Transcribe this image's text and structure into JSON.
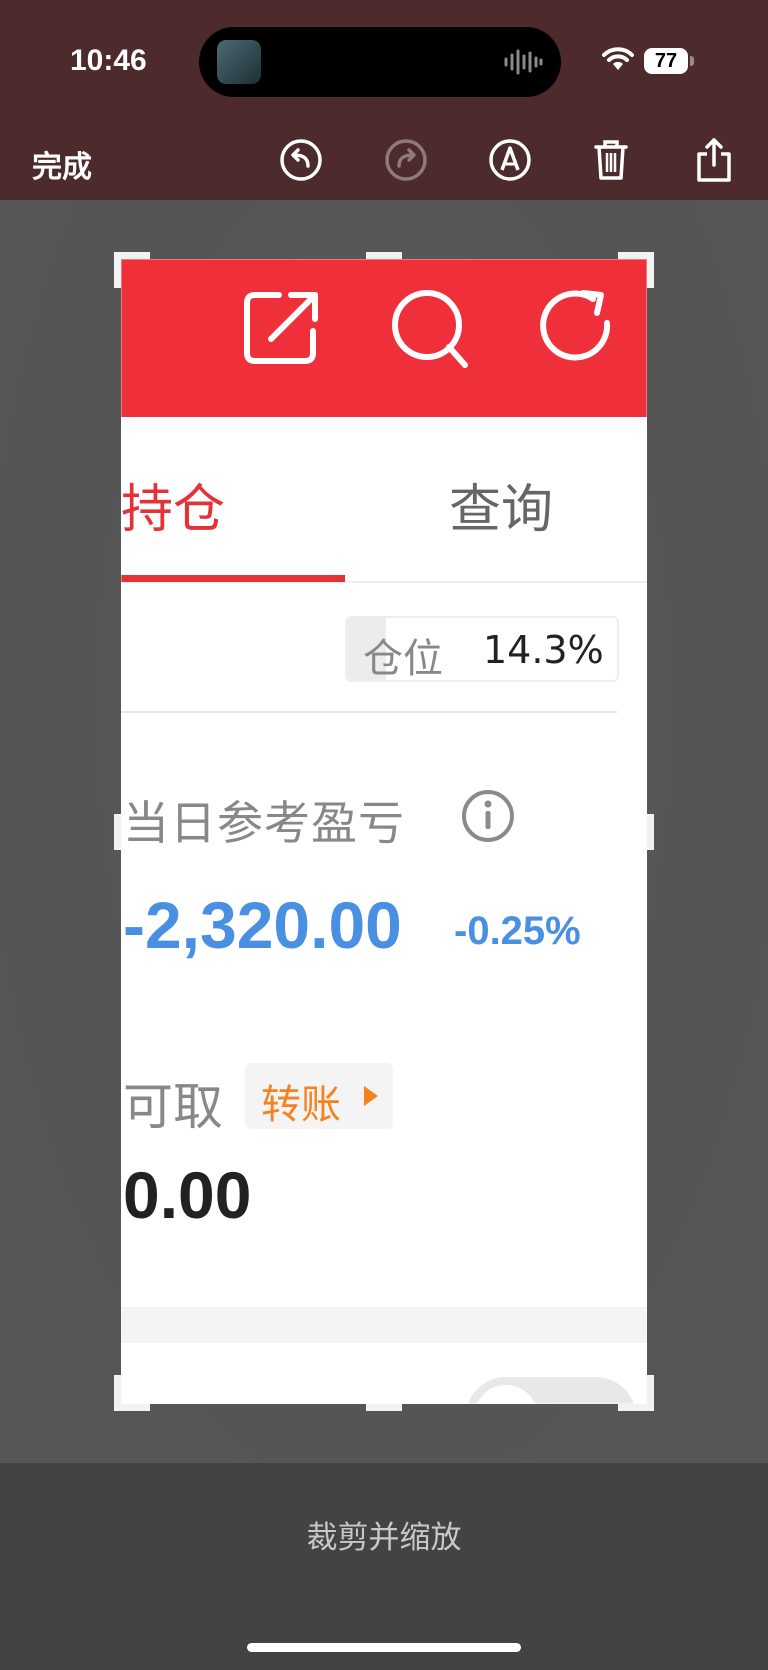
{
  "status_bar": {
    "time": "10:46",
    "battery": "77"
  },
  "toolbar": {
    "done_label": "完成"
  },
  "app": {
    "tabs": [
      "持仓",
      "查询"
    ],
    "position": {
      "label": "仓位",
      "value": "14.3%",
      "fraction": 0.143
    },
    "daily_pnl": {
      "label": "当日参考盈亏",
      "value": "-2,320.00",
      "percent": "-0.25%"
    },
    "available": {
      "label": "可取",
      "transfer_label": "转账",
      "value": "0.00"
    }
  },
  "bottom": {
    "crop_label": "裁剪并缩放"
  },
  "colors": {
    "header_red": "#ef2f3a",
    "accent_red": "#e53238",
    "loss_blue": "#4a90e2",
    "transfer_orange": "#f5821f"
  }
}
